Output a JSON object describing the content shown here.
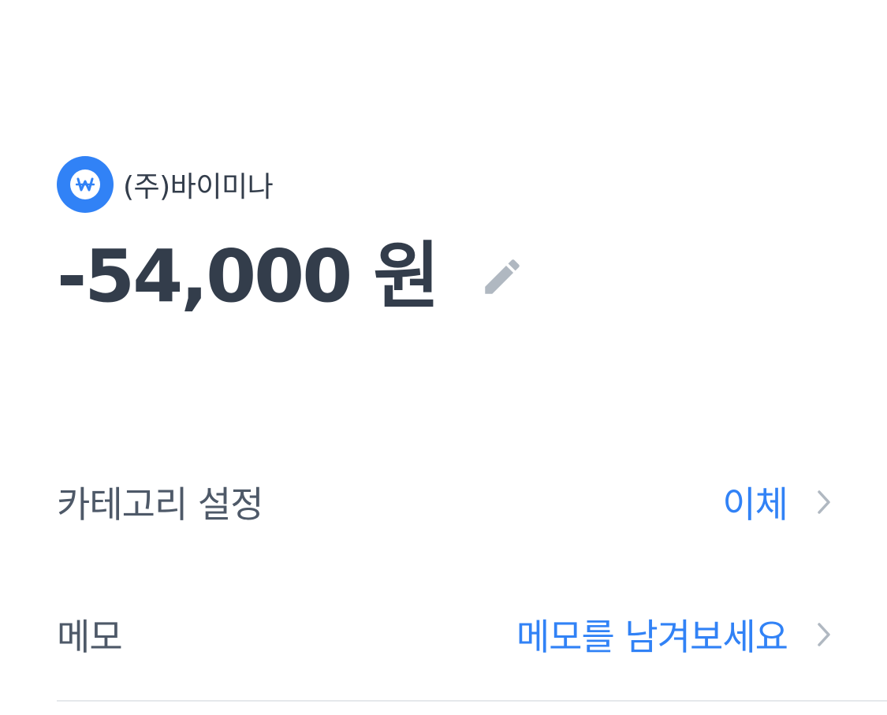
{
  "merchant": {
    "name": "(주)바이미나",
    "icon": "won-icon",
    "icon_glyph": "₩"
  },
  "transaction": {
    "amount": "-54,000 원",
    "edit_icon": "pencil-icon"
  },
  "category_row": {
    "label": "카테고리 설정",
    "value": "이체",
    "icon": "chevron-right-icon"
  },
  "memo_row": {
    "label": "메모",
    "placeholder": "메모를 남겨보세요",
    "icon": "chevron-right-icon"
  },
  "colors": {
    "accent": "#3182f6",
    "text_primary": "#333d4b",
    "text_secondary": "#4e5968",
    "icon_gray": "#b0b8c1",
    "divider": "#e5e8eb"
  }
}
